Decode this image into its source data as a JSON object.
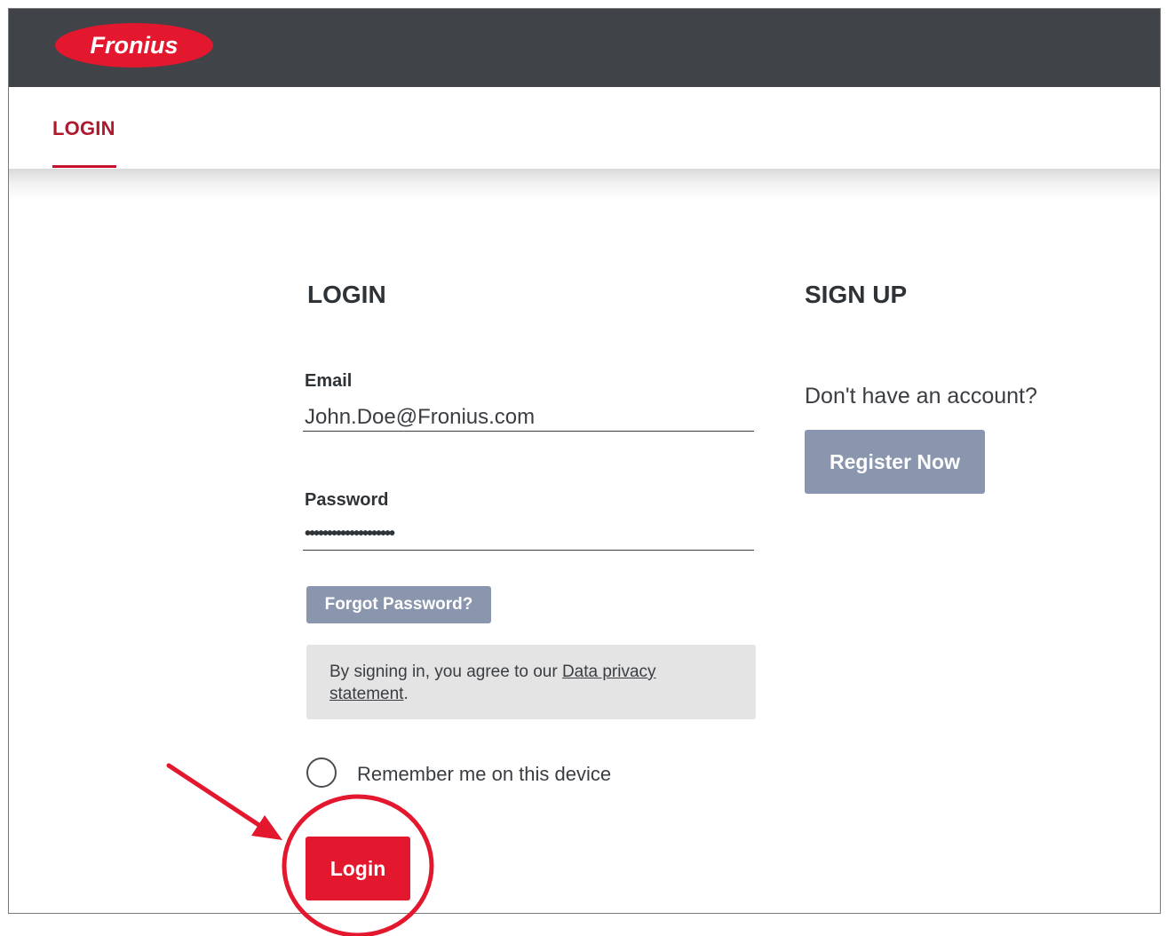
{
  "header": {
    "logo_text": "Fronius",
    "brand_color": "#e3172d",
    "bar_color": "#404348"
  },
  "tabs": {
    "active_label": "LOGIN"
  },
  "login": {
    "heading": "LOGIN",
    "email_label": "Email",
    "email_value": "John.Doe@Fronius.com",
    "password_label": "Password",
    "password_value": "••••••••••••••••••••",
    "forgot_label": "Forgot Password?",
    "notice_prefix": "By signing in, you agree to our ",
    "notice_link": "Data privacy statement",
    "notice_suffix": ".",
    "remember_label": "Remember me on this device",
    "submit_label": "Login"
  },
  "signup": {
    "heading": "SIGN UP",
    "prompt": "Don't have an account?",
    "register_label": "Register Now"
  },
  "annotation": {
    "color": "#e3172d",
    "target": "login-button"
  }
}
